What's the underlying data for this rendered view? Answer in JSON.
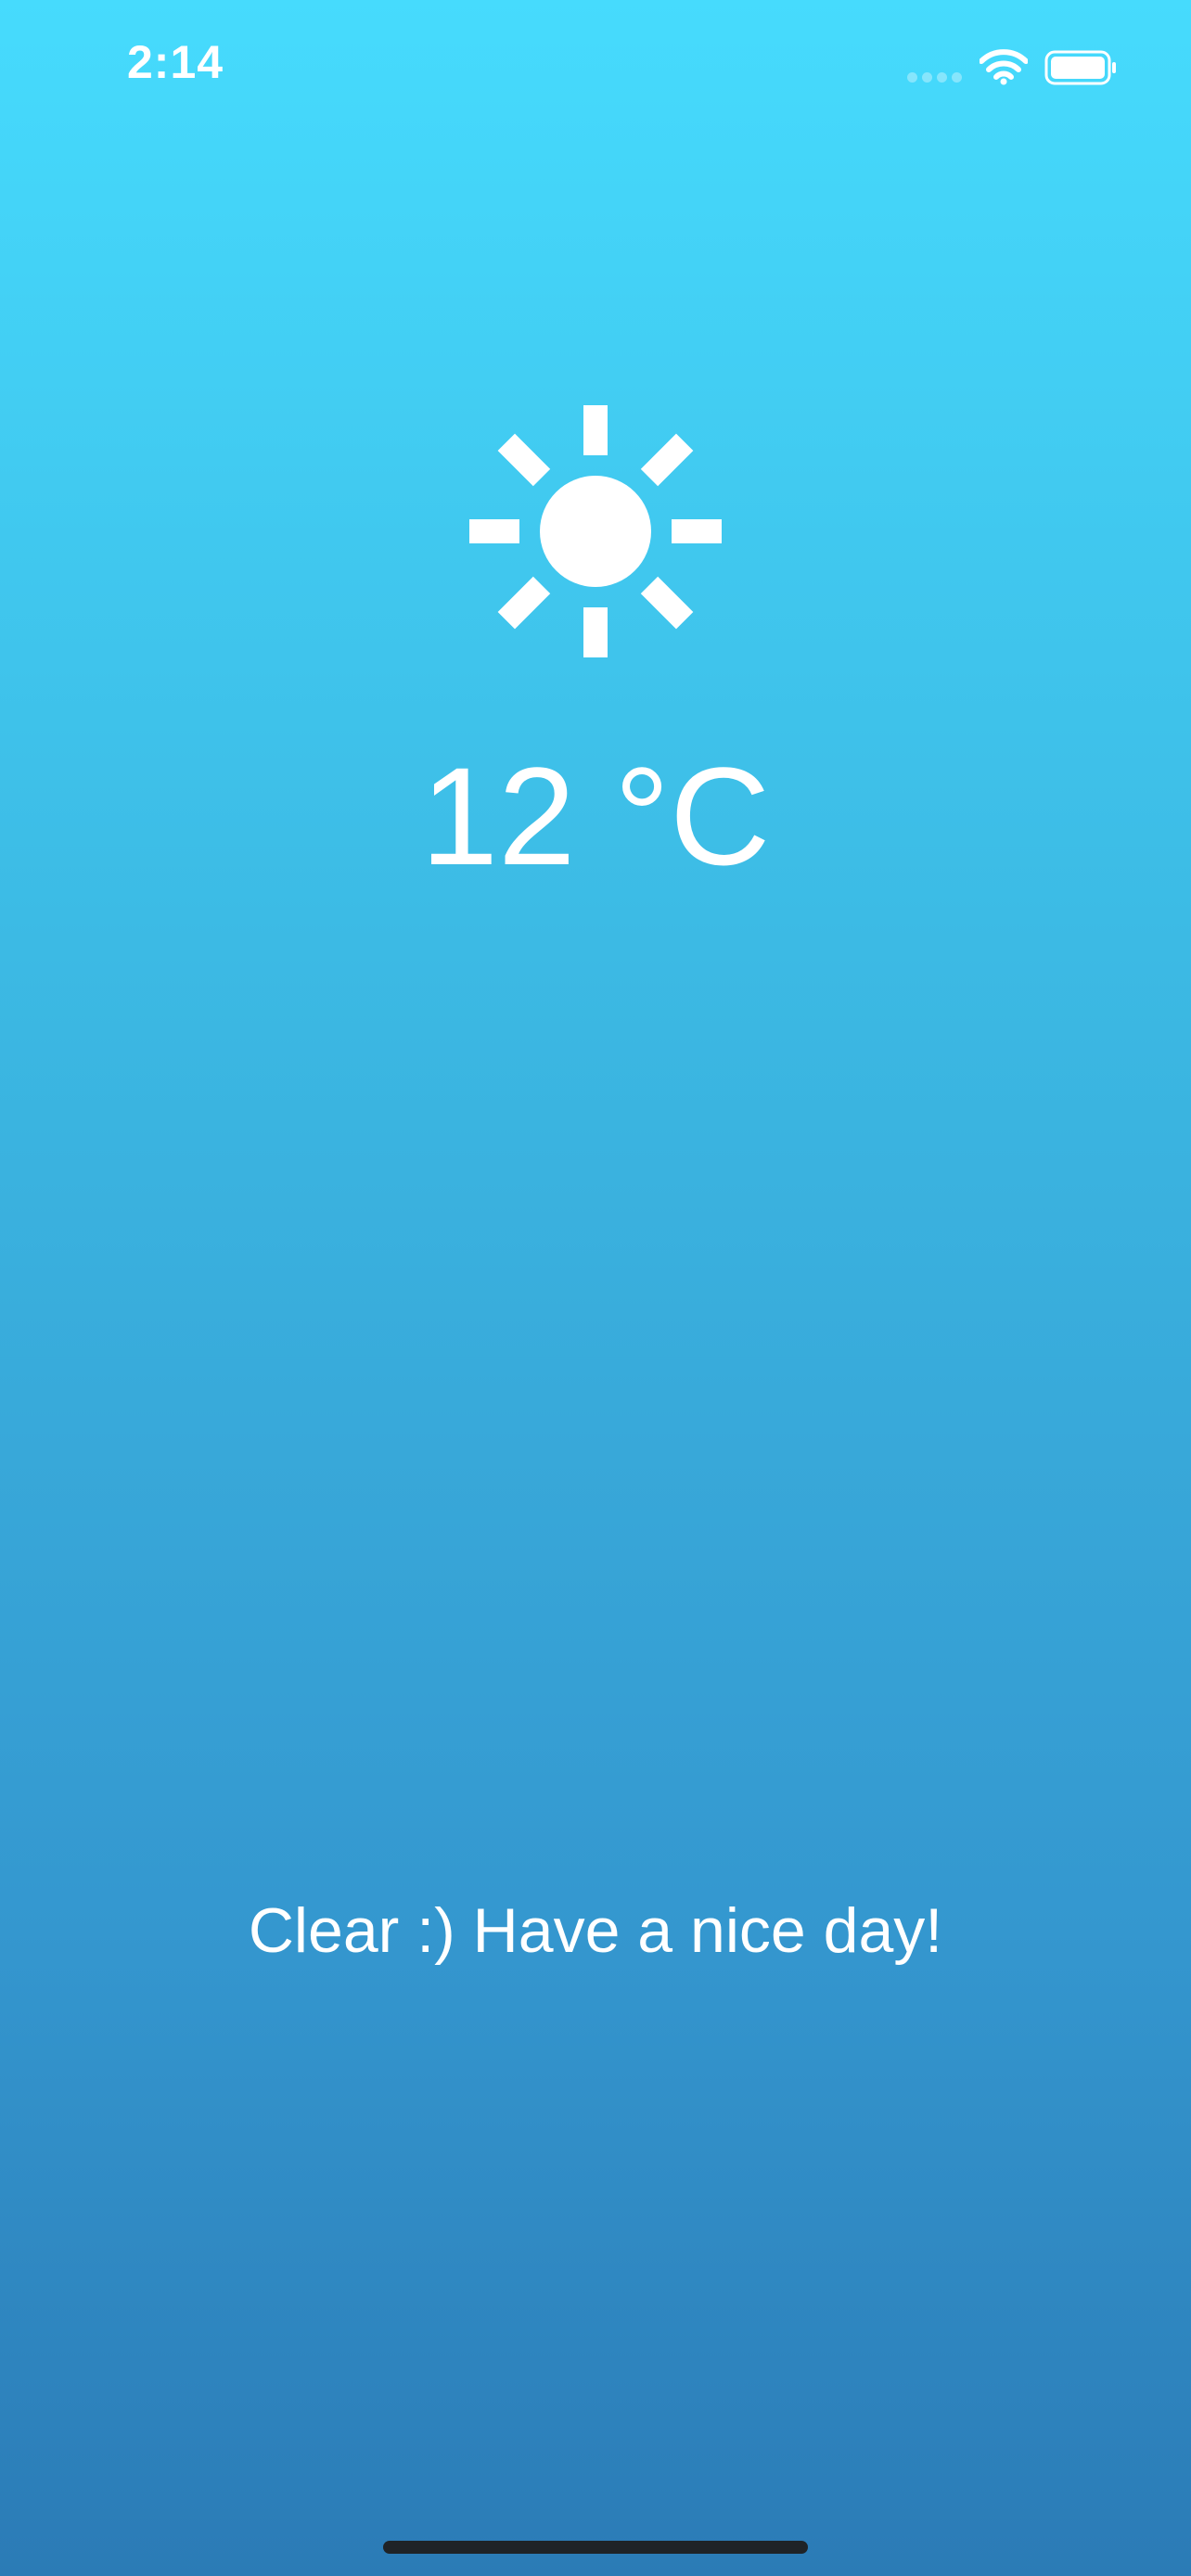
{
  "status_bar": {
    "time": "2:14",
    "signal_icon": "cellular-signal-icon",
    "wifi_icon": "wifi-icon",
    "battery_icon": "battery-icon"
  },
  "weather": {
    "condition_icon": "sun-icon",
    "temperature": "12 °C",
    "message": "Clear :) Have a nice day!"
  },
  "colors": {
    "gradient_top": "#46dbfd",
    "gradient_bottom": "#2b7bb6",
    "foreground": "#ffffff"
  }
}
